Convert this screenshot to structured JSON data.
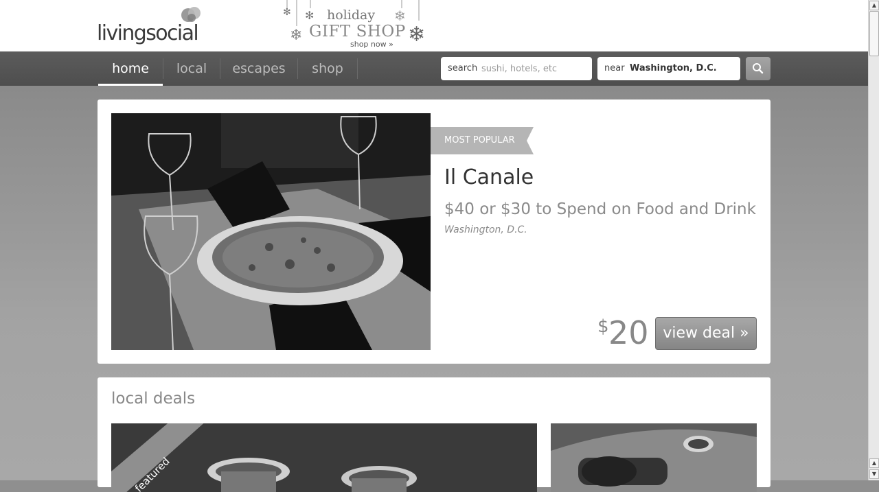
{
  "header": {
    "logo_text": "livingsocial",
    "promo": {
      "line1": "holiday",
      "line2": "GIFT SHOP",
      "line3": "shop now »"
    }
  },
  "nav": {
    "items": [
      {
        "label": "home",
        "active": true
      },
      {
        "label": "local",
        "active": false
      },
      {
        "label": "escapes",
        "active": false
      },
      {
        "label": "shop",
        "active": false
      }
    ],
    "search": {
      "label": "search",
      "placeholder": "sushi, hotels, etc"
    },
    "near": {
      "label": "near",
      "value": "Washington, D.C."
    },
    "search_button_icon": "magnifier-icon"
  },
  "hero_deal": {
    "badge": "MOST POPULAR",
    "title": "Il Canale",
    "subtitle": "$40 or $30 to Spend on Food and Drink",
    "location": "Washington, D.C.",
    "price_currency": "$",
    "price_value": "20",
    "button_label": "view deal »"
  },
  "local_deals": {
    "title": "local deals",
    "featured_badge": "featured"
  },
  "colors": {
    "nav_bg": "#555555",
    "card_bg": "#ffffff",
    "button_bg": "#999999"
  }
}
